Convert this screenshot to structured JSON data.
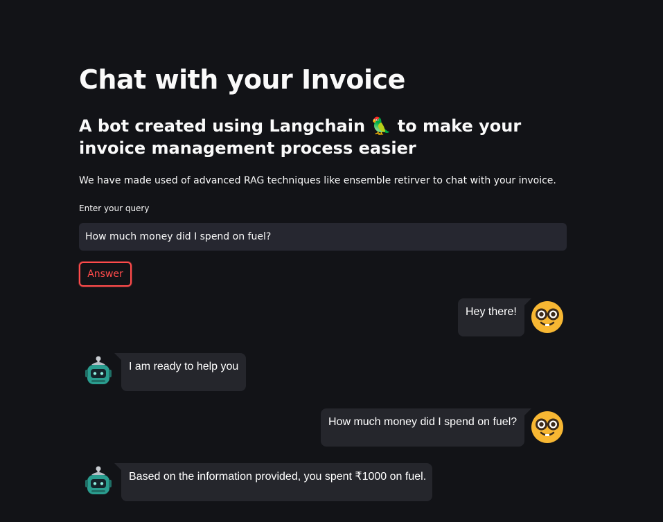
{
  "header": {
    "title": "Chat with your Invoice",
    "subtitle": "A bot created using Langchain 🦜 to make your invoice management process easier",
    "description": "We have made used of advanced RAG techniques like ensemble retirver to chat with your invoice."
  },
  "query": {
    "label": "Enter your query",
    "value": "How much money did I spend on fuel?"
  },
  "answer_button": {
    "label": "Answer"
  },
  "messages": [
    {
      "role": "user",
      "text": "Hey there!"
    },
    {
      "role": "bot",
      "text": "I am ready to help you"
    },
    {
      "role": "user",
      "text": "How much money did I spend on fuel?"
    },
    {
      "role": "bot",
      "text": "Based on the information provided, you spent ₹1000 on fuel."
    }
  ],
  "colors": {
    "background": "#121317",
    "input_background": "#262730",
    "bubble_background": "#25262c",
    "accent": "#ff4b4b",
    "user_avatar": "#f7b733",
    "bot_avatar": "#2a9d8f"
  },
  "icons": {
    "user_avatar": "nerd-face-icon",
    "bot_avatar": "robot-icon"
  }
}
